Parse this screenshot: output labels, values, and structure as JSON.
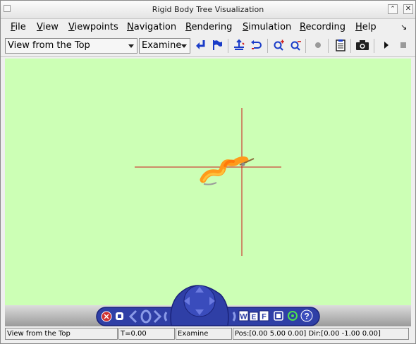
{
  "window": {
    "title": "Rigid Body Tree Visualization",
    "close_glyph": "✕",
    "restore_glyph": "⌃"
  },
  "menu": {
    "items": [
      "File",
      "View",
      "Viewpoints",
      "Navigation",
      "Rendering",
      "Simulation",
      "Recording",
      "Help"
    ],
    "overflow_glyph": "↘"
  },
  "toolbar": {
    "viewpoint_select": "View from the Top",
    "mode_select": "Examine",
    "icons": [
      "return-arrow-icon",
      "flag-icon",
      "straighten-up-icon",
      "undo-icon",
      "zoom-in-icon",
      "zoom-out-icon",
      "record-dot-icon",
      "clipboard-icon",
      "camera-icon",
      "play-icon",
      "stop-icon"
    ]
  },
  "navigator": {
    "labels": [
      "W",
      "E",
      "F"
    ],
    "help_glyph": "?"
  },
  "status": {
    "viewpoint": "View from the Top",
    "time": "T=0.00",
    "mode": "Examine",
    "position_direction": "Pos:[0.00 5.00 0.00] Dir:[0.00 -1.00 0.00]"
  },
  "colors": {
    "viewport_bg": "#ccffb5",
    "axis_lines": "#cc1a1a",
    "robot_body": "#ff9a1a",
    "navigator_blue": "#2f3fa6",
    "toolbar_blue": "#1a3cc8"
  }
}
